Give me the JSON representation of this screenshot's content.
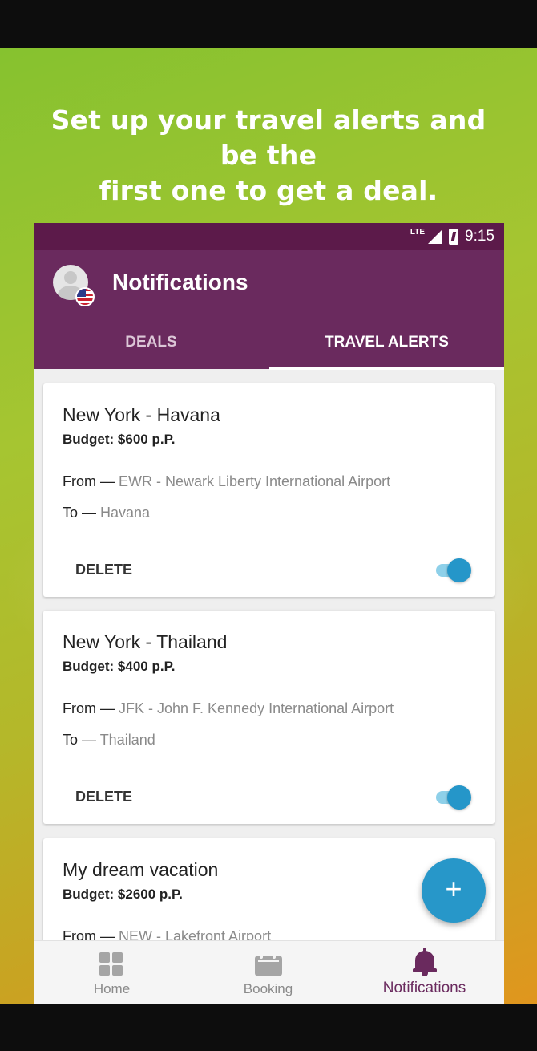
{
  "promo": {
    "headline_line1": "Set up your travel alerts and be the",
    "headline_line2": "first one to get a deal."
  },
  "status_bar": {
    "network": "LTE",
    "time": "9:15"
  },
  "app_bar": {
    "title": "Notifications"
  },
  "tabs": [
    {
      "label": "DEALS",
      "selected": false
    },
    {
      "label": "TRAVEL ALERTS",
      "selected": true
    }
  ],
  "alerts": [
    {
      "title": "New York - Havana",
      "budget": "Budget: $600 p.P.",
      "from_label": "From — ",
      "from_value": "EWR - Newark Liberty International Airport",
      "to_label": "To — ",
      "to_value": "Havana",
      "delete_label": "DELETE",
      "enabled": true
    },
    {
      "title": "New York - Thailand",
      "budget": "Budget: $400 p.P.",
      "from_label": "From — ",
      "from_value": "JFK - John F. Kennedy International Airport",
      "to_label": "To — ",
      "to_value": "Thailand",
      "delete_label": "DELETE",
      "enabled": true
    },
    {
      "title": "My dream vacation",
      "budget": "Budget: $2600 p.P.",
      "from_label": "From — ",
      "from_value": "NEW - Lakefront Airport"
    }
  ],
  "fab": {
    "icon": "plus-icon",
    "glyph": "+"
  },
  "bottom_nav": [
    {
      "label": "Home",
      "icon": "grid-icon",
      "active": false
    },
    {
      "label": "Booking",
      "icon": "calendar-icon",
      "active": false
    },
    {
      "label": "Notifications",
      "icon": "bell-icon",
      "active": true
    }
  ],
  "colors": {
    "status_bar": "#5c1a4a",
    "app_bar": "#6a2a5e",
    "accent": "#2797c9",
    "toggle_track": "#8ed0e9",
    "active_nav": "#6a2a5e"
  }
}
